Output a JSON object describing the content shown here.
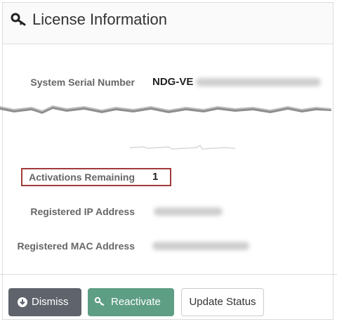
{
  "panel": {
    "title": "License Information"
  },
  "fields": {
    "serial": {
      "label": "System Serial Number",
      "value": "NDG-VE"
    },
    "activations": {
      "label": "Activations Remaining",
      "value": "1"
    },
    "ip": {
      "label": "Registered IP Address",
      "value": ""
    },
    "mac": {
      "label": "Registered MAC Address",
      "value": ""
    }
  },
  "buttons": {
    "dismiss": "Dismiss",
    "reactivate": "Reactivate",
    "update": "Update Status"
  },
  "colors": {
    "highlight_border": "#a23a3a",
    "dismiss_bg": "#5f636b",
    "reactivate_bg": "#5e9e85"
  },
  "icons": {
    "title": "key-icon",
    "dismiss": "down-arrow-circle-icon",
    "reactivate": "key-icon"
  }
}
